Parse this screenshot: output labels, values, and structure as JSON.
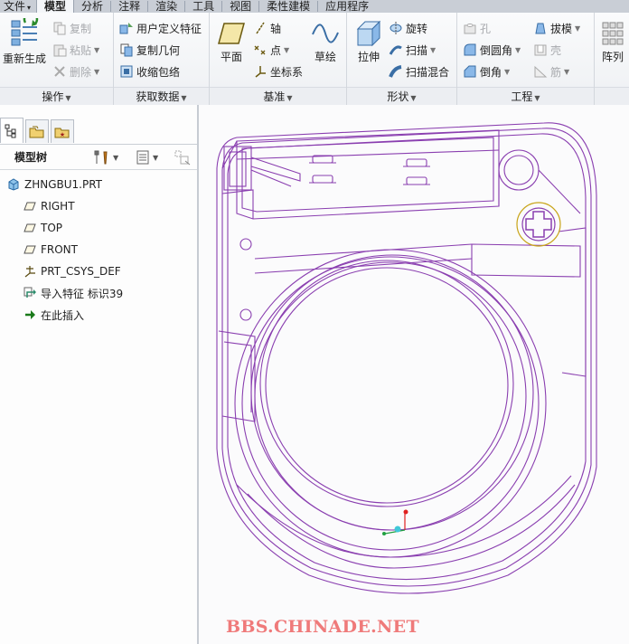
{
  "menu": {
    "file": "文件",
    "tabs": [
      "模型",
      "分析",
      "注释",
      "渲染",
      "工具",
      "视图",
      "柔性建模",
      "应用程序"
    ]
  },
  "ribbon": {
    "operations": {
      "label": "操作",
      "regenerate": "重新生成",
      "copy": "复制",
      "paste": "粘贴",
      "delete": "删除"
    },
    "get_data": {
      "label": "获取数据",
      "udf": "用户定义特征",
      "copy_geometry": "复制几何",
      "shrinkwrap": "收缩包络"
    },
    "datum": {
      "label": "基准",
      "plane": "平面",
      "axis": "轴",
      "point": "点",
      "csys": "坐标系",
      "sketch": "草绘"
    },
    "shapes": {
      "label": "形状",
      "extrude": "拉伸",
      "revolve": "旋转",
      "sweep": "扫描",
      "swept_blend": "扫描混合"
    },
    "engineering": {
      "label": "工程",
      "hole": "孔",
      "round": "倒圆角",
      "chamfer": "倒角",
      "draft": "拔模",
      "shell": "壳",
      "rib": "筋"
    },
    "pattern": {
      "label": "阵列"
    }
  },
  "model_tree": {
    "title": "模型树",
    "items": [
      {
        "label": "ZHNGBU1.PRT",
        "icon": "part-icon"
      },
      {
        "label": "RIGHT",
        "icon": "datum-plane-icon"
      },
      {
        "label": "TOP",
        "icon": "datum-plane-icon"
      },
      {
        "label": "FRONT",
        "icon": "datum-plane-icon"
      },
      {
        "label": "PRT_CSYS_DEF",
        "icon": "csys-icon"
      },
      {
        "label": "导入特征 标识39",
        "icon": "import-feature-icon"
      },
      {
        "label": "在此插入",
        "icon": "insert-here-arrow-icon"
      }
    ]
  },
  "watermark": "BBS.CHINADE.NET",
  "colors": {
    "model_wire": "#8a3fb0",
    "highlight": "#c8a418",
    "watermark": "#ef7a7a"
  }
}
